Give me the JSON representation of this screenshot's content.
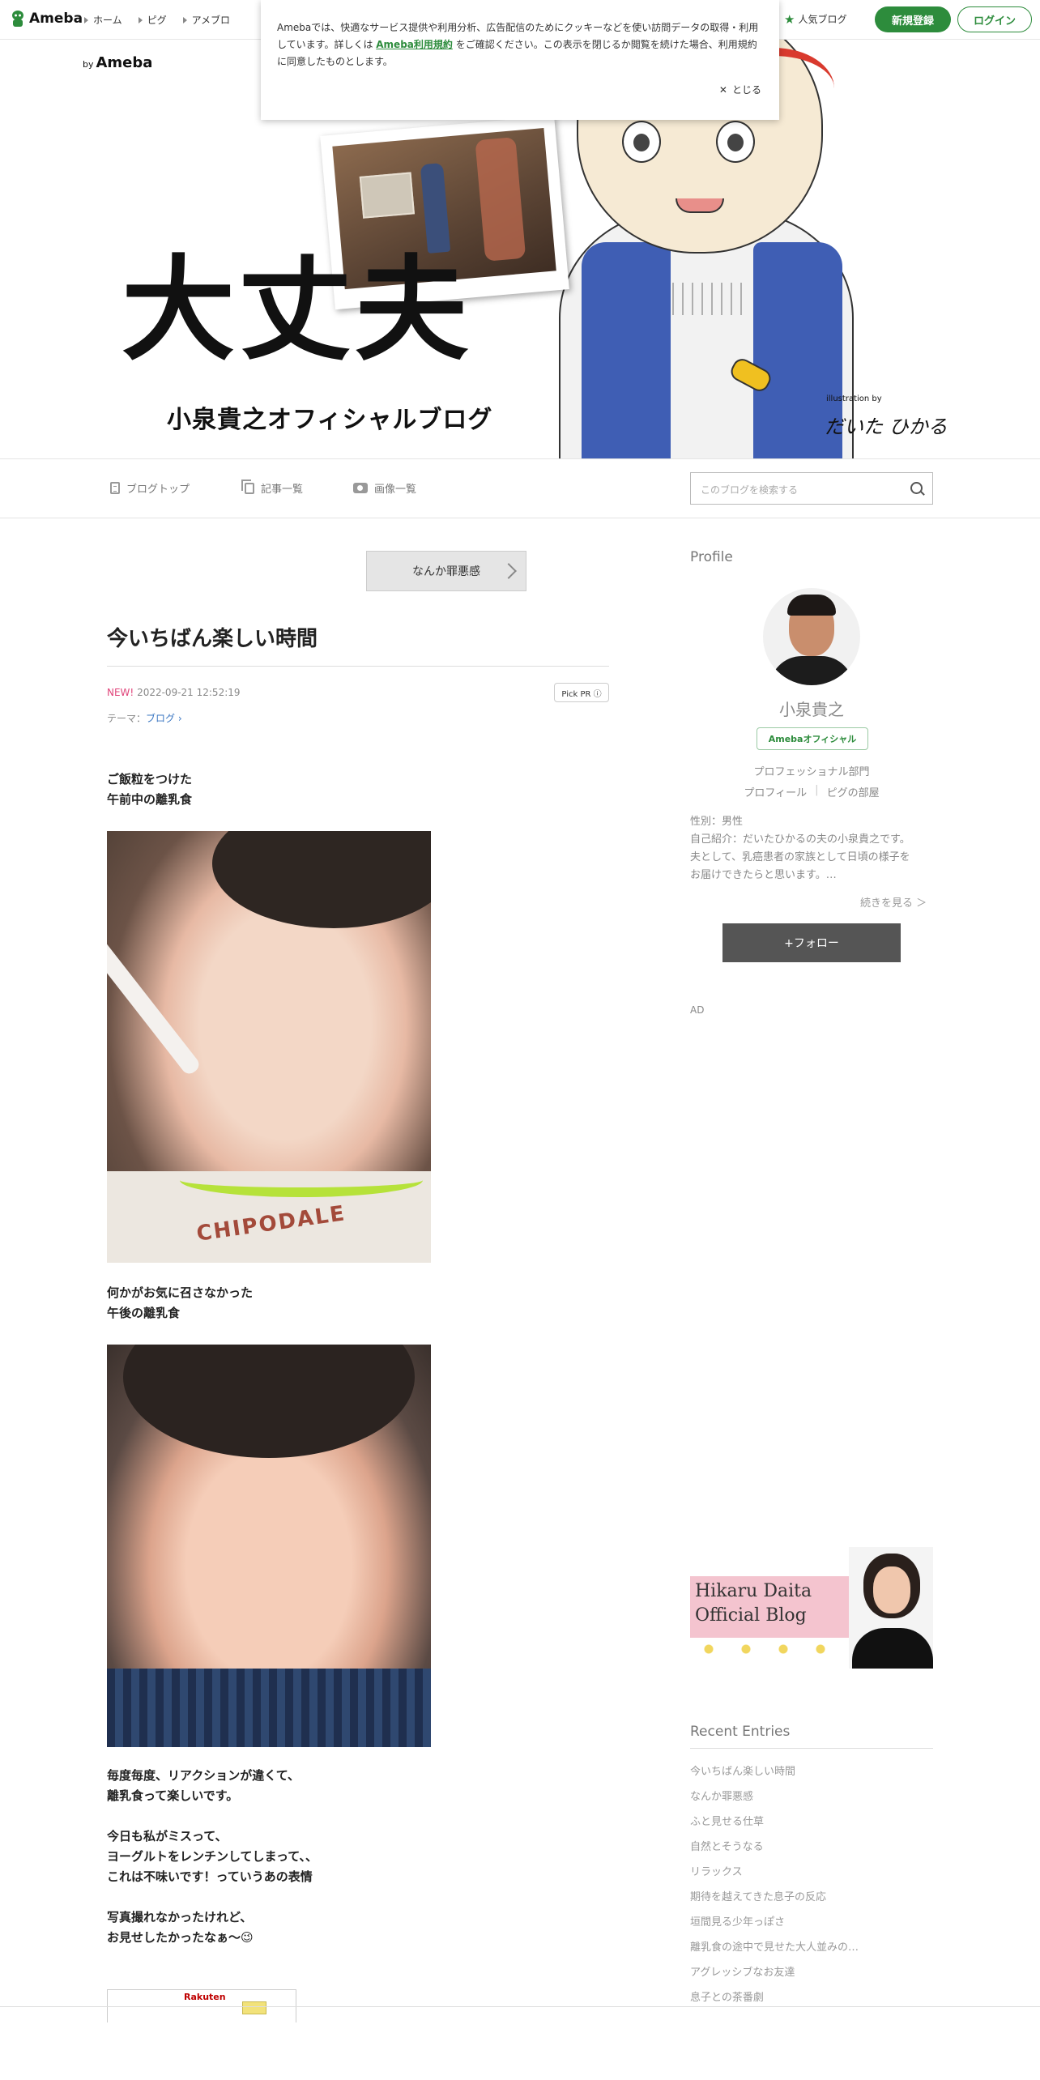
{
  "global_header": {
    "logo": "Ameba",
    "nav": [
      "ホーム",
      "ピグ",
      "アメブロ"
    ],
    "popular": "人気ブログ",
    "signup": "新規登録",
    "login": "ログイン"
  },
  "cookie_notice": {
    "text_before": "Amebaでは、快適なサービス提供や利用分析、広告配信のためにクッキーなどを使い訪問データの取得・利用しています。詳しくは ",
    "link": "Ameba利用規約",
    "text_after": " をご確認ください。この表示を閉じるか閲覧を続けた場合、利用規約に同意したものとします。",
    "close": "とじる"
  },
  "banner": {
    "by_prefix": "by",
    "by_brand": "Ameba",
    "title": "大丈夫",
    "subtitle": "小泉貴之オフィシャルブログ",
    "illustration_by": "illustration by",
    "illustrator": "だいた ひかる"
  },
  "blog_nav": {
    "top": "ブログトップ",
    "articles": "記事一覧",
    "images": "画像一覧",
    "search_placeholder": "このブログを検索する"
  },
  "article": {
    "prev_link": "なんか罪悪感",
    "title": "今いちばん楽しい時間",
    "new_label": "NEW!",
    "datetime": "2022-09-21 12:52:19",
    "pickpr": "Pick PR ⓘ",
    "theme_label": "テーマ：",
    "theme_value": "ブログ",
    "para1": [
      "ご飯粒をつけた",
      "午前中の離乳食"
    ],
    "image1_text": "CHIPODALE",
    "para2": [
      "何かがお気に召さなかった",
      "午後の離乳食"
    ],
    "para3": [
      "毎度毎度、リアクションが違くて、",
      "離乳食って楽しいです。",
      "",
      "今日も私がミスって、",
      "ヨーグルトをレンチンしてしまって、、",
      "これは不味いです！っていうあの表情",
      "",
      "写真撮れなかったけれど、",
      "お見せしたかったなぁ〜😉"
    ],
    "rakuten": "Rakuten"
  },
  "sidebar": {
    "profile_heading": "Profile",
    "name": "小泉貴之",
    "badge": "Amebaオフィシャル",
    "category": "プロフェッショナル部門",
    "links": [
      "プロフィール",
      "ピグの部屋"
    ],
    "info": [
      "性別：男性",
      "自己紹介：だいたひかるの夫の小泉貴之です。",
      "夫として、乳癌患者の家族として日頃の様子を",
      "お届けできたらと思います。…"
    ],
    "read_more": "続きを見る ＞",
    "follow": "+フォロー",
    "ad": "AD",
    "banner_line1": "Hikaru Daita",
    "banner_line2": "Official Blog",
    "recent_heading": "Recent Entries",
    "recent_entries": [
      "今いちばん楽しい時間",
      "なんか罪悪感",
      "ふと見せる仕草",
      "自然とそうなる",
      "リラックス",
      "期待を越えてきた息子の反応",
      "垣間見る少年っぽさ",
      "離乳食の途中で見せた大人並みの…",
      "アグレッシブなお友達",
      "息子との茶番劇"
    ]
  }
}
